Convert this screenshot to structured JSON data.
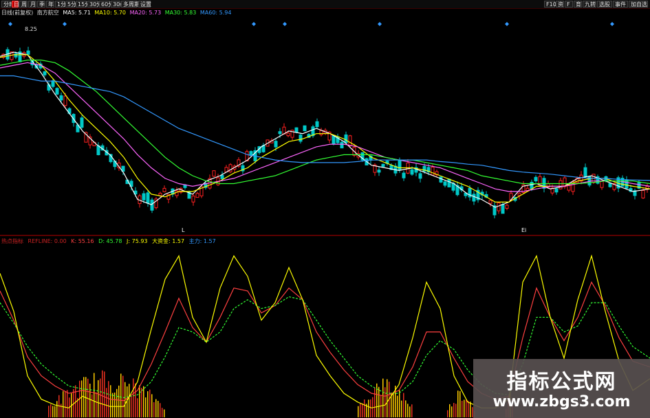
{
  "toolbar": {
    "left_buttons": [
      "分时",
      "日",
      "周",
      "月",
      "季",
      "年",
      "1分",
      "5分",
      "15分",
      "30分",
      "60分",
      "30s",
      "多周期",
      "设置"
    ],
    "active": "日",
    "right_buttons": [
      "F10",
      "资",
      "F",
      "育",
      "九转",
      "选股",
      "事件",
      "加自选"
    ]
  },
  "ma_legend": {
    "period": "日线(前复权)",
    "name": "南方航空",
    "items": [
      {
        "label": "MA5: 5.71",
        "color": "#ffffff"
      },
      {
        "label": "MA10: 5.70",
        "color": "#ffff00"
      },
      {
        "label": "MA20: 5.73",
        "color": "#ff66ff"
      },
      {
        "label": "MA30: 5.83",
        "color": "#33ff33"
      },
      {
        "label": "MA60: 5.94",
        "color": "#3399ff"
      }
    ]
  },
  "indicator_legend": {
    "name": "热点指标",
    "items": [
      {
        "label": "REFLINE: 0.00",
        "color": "#cc2222"
      },
      {
        "label": "K: 55.16",
        "color": "#ff4040"
      },
      {
        "label": "D: 45.78",
        "color": "#33ff33"
      },
      {
        "label": "J: 75.93",
        "color": "#ffff00"
      },
      {
        "label": "大资金: 1.57",
        "color": "#ffff00"
      },
      {
        "label": "主力: 1.57",
        "color": "#3399ff"
      }
    ]
  },
  "price_high_label": "8.25",
  "markers": [
    "L",
    "Ei"
  ],
  "watermark": {
    "title": "指标公式网",
    "url": "www.zbgs3.com"
  },
  "colors": {
    "up": "#ff2020",
    "down": "#00c8c8",
    "separator": "#7a0000"
  },
  "chart_data": {
    "type": "line",
    "panels": [
      {
        "name": "price",
        "series": [
          {
            "name": "MA5",
            "color": "#ffffff",
            "x": [
              0,
              20,
              40,
              60,
              80,
              100,
              120,
              140,
              160,
              180,
              200,
              220,
              240,
              260,
              280,
              300,
              320,
              340,
              360,
              380,
              400,
              420,
              440,
              460,
              480,
              500,
              520,
              540,
              560,
              580,
              600,
              620,
              640,
              660,
              680,
              700,
              720,
              740,
              760,
              780,
              800,
              820,
              840,
              860,
              880,
              900,
              920,
              945
            ],
            "y": [
              7.92,
              8.0,
              7.95,
              7.6,
              7.2,
              6.85,
              6.5,
              6.25,
              6.05,
              5.7,
              5.2,
              5.1,
              5.3,
              5.4,
              5.3,
              5.55,
              5.65,
              5.8,
              5.95,
              6.2,
              6.35,
              6.5,
              6.45,
              6.55,
              6.45,
              6.3,
              6.05,
              5.85,
              5.8,
              5.75,
              5.8,
              5.7,
              5.6,
              5.5,
              5.3,
              5.2,
              5.05,
              5.15,
              5.45,
              5.5,
              5.4,
              5.45,
              5.6,
              5.65,
              5.55,
              5.45,
              5.35,
              5.4
            ]
          },
          {
            "name": "MA10",
            "color": "#ffff00",
            "x": [
              0,
              20,
              40,
              60,
              80,
              100,
              120,
              140,
              160,
              180,
              200,
              220,
              240,
              260,
              280,
              300,
              320,
              340,
              360,
              380,
              400,
              420,
              440,
              460,
              480,
              500,
              520,
              540,
              560,
              580,
              600,
              620,
              640,
              660,
              680,
              700,
              720,
              740,
              760,
              780,
              800,
              820,
              840,
              860,
              880,
              900,
              920,
              945
            ],
            "y": [
              7.9,
              7.95,
              7.95,
              7.75,
              7.45,
              7.1,
              6.8,
              6.55,
              6.3,
              6.0,
              5.6,
              5.3,
              5.25,
              5.35,
              5.35,
              5.45,
              5.55,
              5.7,
              5.8,
              6.0,
              6.15,
              6.3,
              6.35,
              6.45,
              6.45,
              6.35,
              6.2,
              6.0,
              5.9,
              5.8,
              5.8,
              5.75,
              5.65,
              5.55,
              5.45,
              5.3,
              5.15,
              5.15,
              5.3,
              5.45,
              5.45,
              5.45,
              5.55,
              5.6,
              5.6,
              5.5,
              5.45,
              5.4
            ]
          },
          {
            "name": "MA20",
            "color": "#ff66ff",
            "x": [
              0,
              20,
              40,
              60,
              80,
              100,
              120,
              140,
              160,
              180,
              200,
              220,
              240,
              260,
              280,
              300,
              320,
              340,
              360,
              380,
              400,
              420,
              440,
              460,
              480,
              500,
              520,
              540,
              560,
              580,
              600,
              620,
              640,
              660,
              680,
              700,
              720,
              740,
              760,
              780,
              800,
              820,
              840,
              860,
              880,
              900,
              920,
              945
            ],
            "y": [
              7.7,
              7.75,
              7.8,
              7.75,
              7.6,
              7.35,
              7.1,
              6.85,
              6.6,
              6.35,
              6.05,
              5.8,
              5.6,
              5.5,
              5.45,
              5.5,
              5.55,
              5.6,
              5.7,
              5.8,
              5.9,
              6.0,
              6.1,
              6.2,
              6.25,
              6.25,
              6.2,
              6.1,
              6.0,
              5.95,
              5.9,
              5.85,
              5.8,
              5.7,
              5.6,
              5.5,
              5.4,
              5.35,
              5.35,
              5.4,
              5.45,
              5.45,
              5.5,
              5.55,
              5.55,
              5.55,
              5.5,
              5.45
            ]
          },
          {
            "name": "MA30",
            "color": "#33ff33",
            "x": [
              0,
              20,
              40,
              60,
              80,
              100,
              120,
              140,
              160,
              180,
              200,
              220,
              240,
              260,
              280,
              300,
              320,
              340,
              360,
              380,
              400,
              420,
              440,
              460,
              480,
              500,
              520,
              540,
              560,
              580,
              600,
              620,
              640,
              660,
              680,
              700,
              720,
              740,
              760,
              780,
              800,
              820,
              840,
              860,
              880,
              900,
              920,
              945
            ],
            "y": [
              7.75,
              7.8,
              7.85,
              7.85,
              7.8,
              7.65,
              7.45,
              7.25,
              7.0,
              6.75,
              6.5,
              6.25,
              6.0,
              5.8,
              5.65,
              5.55,
              5.5,
              5.5,
              5.55,
              5.6,
              5.65,
              5.75,
              5.85,
              5.95,
              6.0,
              6.05,
              6.05,
              6.05,
              6.0,
              5.95,
              5.95,
              5.9,
              5.85,
              5.8,
              5.75,
              5.65,
              5.6,
              5.55,
              5.5,
              5.5,
              5.5,
              5.5,
              5.5,
              5.52,
              5.55,
              5.55,
              5.55,
              5.5
            ]
          },
          {
            "name": "MA60",
            "color": "#3399ff",
            "x": [
              0,
              20,
              40,
              60,
              80,
              100,
              120,
              140,
              160,
              180,
              200,
              220,
              240,
              260,
              280,
              300,
              320,
              340,
              360,
              380,
              400,
              420,
              440,
              460,
              480,
              500,
              520,
              540,
              560,
              580,
              600,
              620,
              640,
              660,
              680,
              700,
              720,
              740,
              760,
              780,
              800,
              820,
              840,
              860,
              880,
              900,
              920,
              945
            ],
            "y": [
              7.55,
              7.55,
              7.5,
              7.45,
              7.45,
              7.4,
              7.35,
              7.3,
              7.25,
              7.15,
              7.0,
              6.85,
              6.7,
              6.55,
              6.45,
              6.35,
              6.25,
              6.15,
              6.05,
              6.0,
              5.95,
              5.92,
              5.9,
              5.9,
              5.9,
              5.9,
              5.92,
              5.95,
              5.95,
              5.95,
              5.95,
              5.95,
              5.92,
              5.9,
              5.87,
              5.85,
              5.8,
              5.75,
              5.72,
              5.7,
              5.68,
              5.65,
              5.62,
              5.6,
              5.6,
              5.58,
              5.57,
              5.56
            ]
          }
        ],
        "ylim": [
          4.75,
          8.6
        ]
      },
      {
        "name": "indicator",
        "series": [
          {
            "name": "K",
            "color": "#ff4040",
            "x": [
              0,
              20,
              40,
              60,
              80,
              100,
              120,
              140,
              160,
              180,
              200,
              220,
              240,
              260,
              280,
              300,
              320,
              340,
              360,
              380,
              400,
              420,
              440,
              460,
              480,
              500,
              520,
              540,
              560,
              580,
              600,
              620,
              640,
              660,
              680,
              700,
              720,
              740,
              760,
              780,
              800,
              820,
              840,
              860,
              880,
              900,
              920,
              945
            ],
            "y": [
              80,
              60,
              35,
              22,
              15,
              10,
              12,
              10,
              6,
              5,
              12,
              30,
              52,
              75,
              55,
              45,
              62,
              82,
              80,
              65,
              70,
              82,
              74,
              52,
              38,
              26,
              16,
              10,
              8,
              12,
              28,
              52,
              52,
              34,
              18,
              10,
              6,
              8,
              48,
              82,
              62,
              46,
              62,
              86,
              70,
              48,
              32,
              28
            ]
          },
          {
            "name": "D",
            "color": "#33ff33",
            "x": [
              0,
              20,
              40,
              60,
              80,
              100,
              120,
              140,
              160,
              180,
              200,
              220,
              240,
              260,
              280,
              300,
              320,
              340,
              360,
              380,
              400,
              420,
              440,
              460,
              480,
              500,
              520,
              540,
              560,
              580,
              600,
              620,
              640,
              660,
              680,
              700,
              720,
              740,
              760,
              780,
              800,
              820,
              840,
              860,
              880,
              900,
              920,
              945
            ],
            "y": [
              72,
              58,
              42,
              30,
              22,
              15,
              13,
              12,
              9,
              7,
              9,
              18,
              35,
              55,
              52,
              45,
              52,
              68,
              74,
              68,
              70,
              76,
              74,
              60,
              46,
              34,
              22,
              15,
              10,
              10,
              18,
              36,
              46,
              40,
              26,
              16,
              10,
              9,
              30,
              62,
              62,
              52,
              56,
              72,
              72,
              56,
              42,
              34
            ]
          },
          {
            "name": "J",
            "color": "#ffff00",
            "x": [
              0,
              20,
              40,
              60,
              80,
              100,
              120,
              140,
              160,
              180,
              200,
              220,
              240,
              260,
              280,
              300,
              320,
              340,
              360,
              380,
              400,
              420,
              440,
              460,
              480,
              500,
              520,
              540,
              560,
              580,
              600,
              620,
              640,
              660,
              680,
              700,
              720,
              740,
              760,
              780,
              800,
              820,
              840,
              860,
              880,
              900,
              920,
              945
            ],
            "y": [
              92,
              66,
              22,
              6,
              2,
              0,
              8,
              4,
              1,
              1,
              18,
              54,
              88,
              104,
              62,
              45,
              82,
              104,
              90,
              60,
              72,
              96,
              74,
              36,
              22,
              10,
              4,
              0,
              2,
              16,
              48,
              86,
              68,
              22,
              4,
              0,
              0,
              6,
              86,
              104,
              62,
              34,
              74,
              104,
              66,
              32,
              12,
              20
            ]
          }
        ],
        "ylim": [
          -5,
          110
        ]
      }
    ]
  }
}
